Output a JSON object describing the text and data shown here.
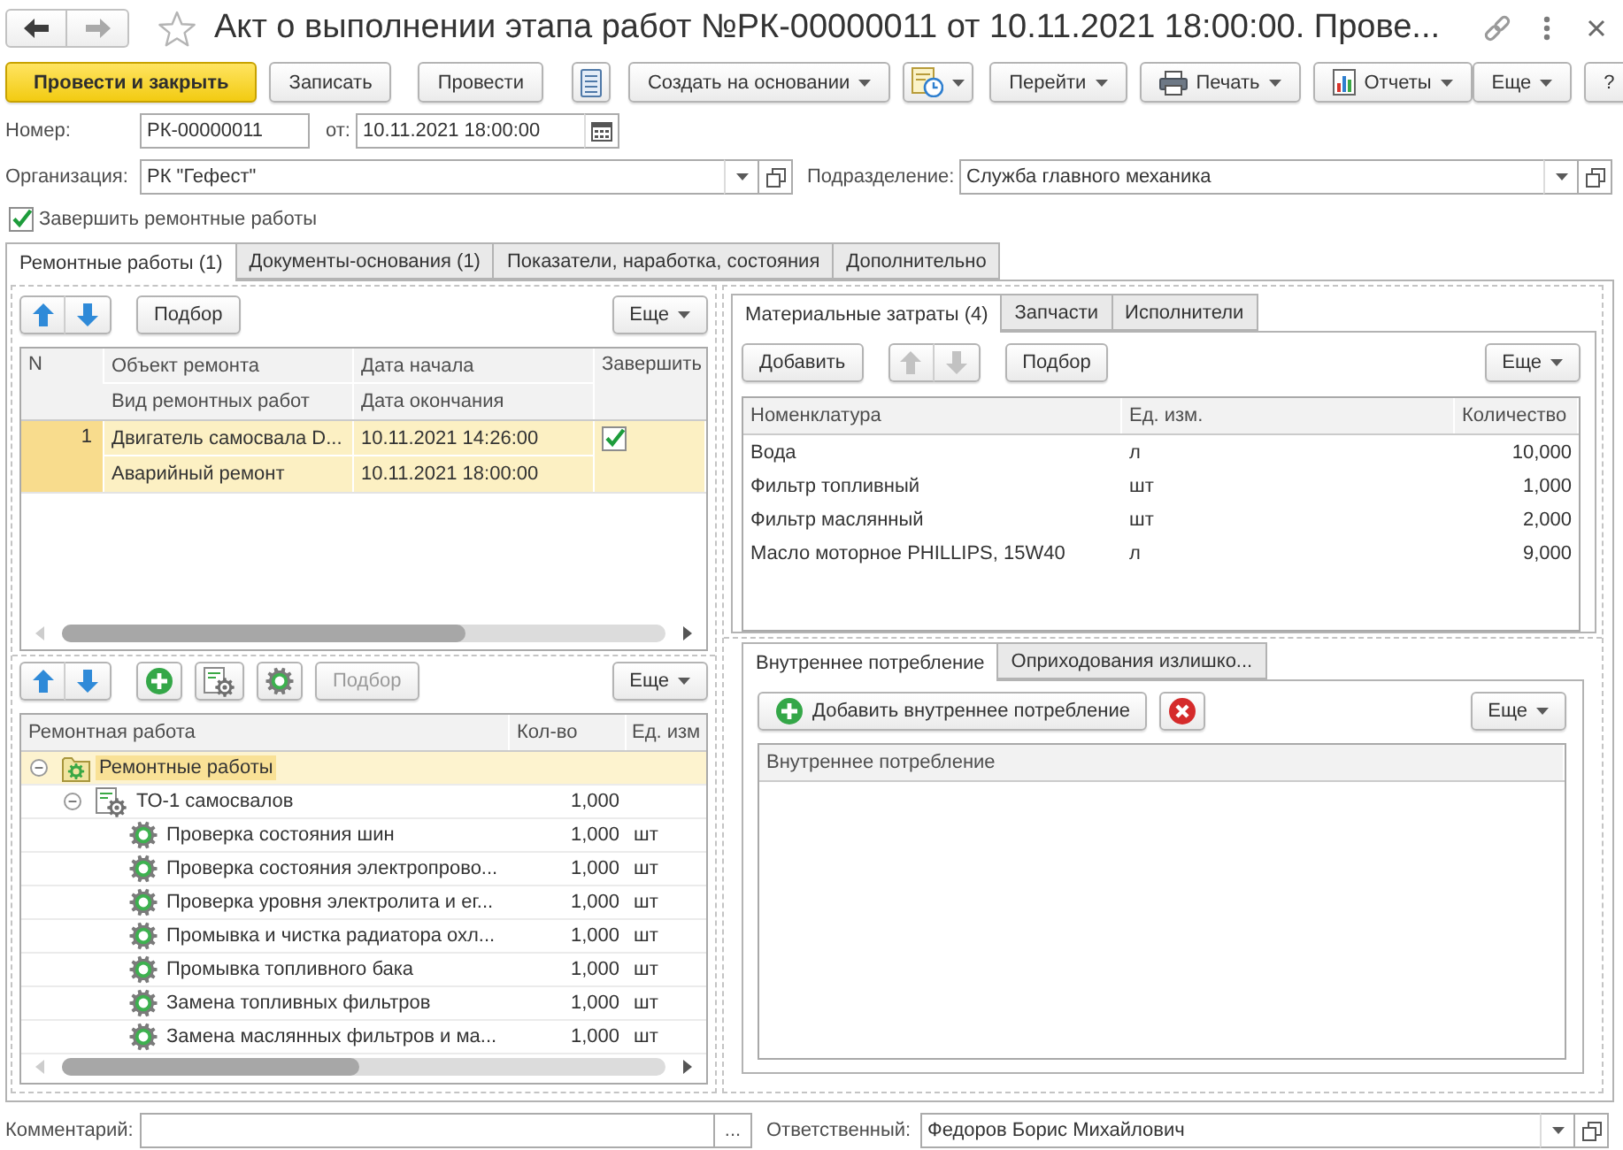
{
  "window": {
    "title": "Акт о выполнении этапа работ №РК-00000011 от 10.11.2021 18:00:00. Прове...",
    "favorite": false,
    "navigation": [
      {
        "kind": "back",
        "disabled": false
      },
      {
        "kind": "forward",
        "disabled": true
      }
    ]
  },
  "commands": {
    "left": [
      {
        "kind": "primary",
        "label": "Провести и закрыть",
        "dropdown": false
      },
      {
        "kind": "button",
        "label": "Записать",
        "dropdown": false
      },
      {
        "kind": "button",
        "label": "Провести",
        "dropdown": false
      },
      {
        "kind": "icon",
        "dropdown": false
      },
      {
        "kind": "button",
        "label": "Создать на основании",
        "dropdown": true
      },
      {
        "kind": "icon",
        "dropdown": true
      },
      {
        "kind": "button",
        "label": "Перейти",
        "dropdown": true
      },
      {
        "kind": "icon-label",
        "label": "Печать",
        "dropdown": true
      },
      {
        "kind": "icon-label",
        "label": "Отчеты",
        "dropdown": true
      }
    ],
    "right": [
      {
        "kind": "button",
        "label": "Еще",
        "dropdown": true
      },
      {
        "kind": "button",
        "label": "?",
        "dropdown": false
      }
    ]
  },
  "header": {
    "number": {
      "label": "Номер:",
      "value": "РК-00000011"
    },
    "date": {
      "label": "от:",
      "value": "10.11.2021 18:00:00"
    },
    "organization": {
      "label": "Организация:",
      "value": "РК \"Гефест\""
    },
    "department": {
      "label": "Подразделение:",
      "value": "Служба главного механика"
    },
    "complete_repairs": {
      "label": "Завершить ремонтные работы",
      "checked": true
    }
  },
  "tabs": [
    {
      "label": "Ремонтные работы (1)",
      "selected": true
    },
    {
      "label": "Документы-основания (1)",
      "selected": false
    },
    {
      "label": "Показатели, наработка, состояния",
      "selected": false
    },
    {
      "label": "Дополнительно",
      "selected": false
    }
  ],
  "repairs": {
    "toolbar": [
      {
        "kind": "move",
        "disabled": false
      },
      {
        "kind": "button",
        "label": "Подбор",
        "disabled": false
      }
    ],
    "more": "Еще",
    "columns": [
      {
        "top": "N"
      },
      {
        "top": "Объект ремонта",
        "bottom": "Вид ремонтных работ"
      },
      {
        "top": "Дата начала",
        "bottom": "Дата окончания"
      },
      {
        "top": "Завершить"
      }
    ],
    "rows": [
      {
        "number": "1",
        "object": "Двигатель самосвала D...",
        "work_type": "Аварийный ремонт",
        "start": "10.11.2021 14:26:00",
        "end": "10.11.2021 18:00:00",
        "complete": true,
        "selected": true
      }
    ]
  },
  "works": {
    "toolbar": [
      {
        "kind": "move",
        "disabled": false
      },
      {
        "kind": "icon"
      },
      {
        "kind": "icon"
      },
      {
        "kind": "icon"
      },
      {
        "kind": "button",
        "label": "Подбор",
        "disabled": true
      }
    ],
    "more": "Еще",
    "columns": [
      "Ремонтная работа",
      "Кол-во",
      "Ед. изм"
    ],
    "nodes": [
      {
        "name": "Ремонтные работы",
        "kind": "folder",
        "expanded": true,
        "selected": true,
        "children": [
          {
            "name": "ТО-1 самосвалов",
            "kind": "group",
            "expanded": true,
            "selected": false,
            "quantity": "1,000",
            "children": [
              {
                "name": "Проверка состояния шин",
                "kind": "work",
                "selected": false,
                "quantity": "1,000",
                "unit": "шт"
              },
              {
                "name": "Проверка состояния электропрово...",
                "kind": "work",
                "selected": false,
                "quantity": "1,000",
                "unit": "шт"
              },
              {
                "name": "Проверка уровня электролита и ег...",
                "kind": "work",
                "selected": false,
                "quantity": "1,000",
                "unit": "шт"
              },
              {
                "name": "Промывка и чистка радиатора охл...",
                "kind": "work",
                "selected": false,
                "quantity": "1,000",
                "unit": "шт"
              },
              {
                "name": "Промывка топливного бака",
                "kind": "work",
                "selected": false,
                "quantity": "1,000",
                "unit": "шт"
              },
              {
                "name": "Замена топливных фильтров",
                "kind": "work",
                "selected": false,
                "quantity": "1,000",
                "unit": "шт"
              },
              {
                "name": "Замена маслянных фильтров и ма...",
                "kind": "work",
                "selected": false,
                "quantity": "1,000",
                "unit": "шт"
              }
            ]
          }
        ]
      }
    ]
  },
  "materials": {
    "tabs": [
      {
        "label": "Материальные затраты (4)",
        "selected": true
      },
      {
        "label": "Запчасти",
        "selected": false
      },
      {
        "label": "Исполнители",
        "selected": false
      }
    ],
    "toolbar": [
      {
        "kind": "button",
        "label": "Добавить",
        "disabled": false
      },
      {
        "kind": "move",
        "disabled": true
      },
      {
        "kind": "button",
        "label": "Подбор",
        "disabled": false
      }
    ],
    "more": "Еще",
    "columns": [
      "Номенклатура",
      "Ед. изм.",
      "Количество"
    ],
    "rows": [
      {
        "name": "Вода",
        "unit": "л",
        "quantity": "10,000"
      },
      {
        "name": "Фильтр топливный",
        "unit": "шт",
        "quantity": "1,000"
      },
      {
        "name": "Фильтр маслянный",
        "unit": "шт",
        "quantity": "2,000"
      },
      {
        "name": "Масло моторное PHILLIPS, 15W40",
        "unit": "л",
        "quantity": "9,000"
      }
    ]
  },
  "consumption": {
    "tabs": [
      {
        "label": "Внутреннее потребление",
        "selected": true
      },
      {
        "label": "Оприходования излишко...",
        "selected": false
      }
    ],
    "toolbar": [
      {
        "kind": "icon-label",
        "label": "Добавить внутреннее потребление"
      },
      {
        "kind": "icon"
      }
    ],
    "more": "Еще",
    "columns": [
      "Внутреннее потребление"
    ]
  },
  "footer": {
    "comment": {
      "label": "Комментарий:",
      "choose_button": "..."
    },
    "responsible": {
      "label": "Ответственный:",
      "value": "Федоров Борис Михайлович"
    }
  }
}
